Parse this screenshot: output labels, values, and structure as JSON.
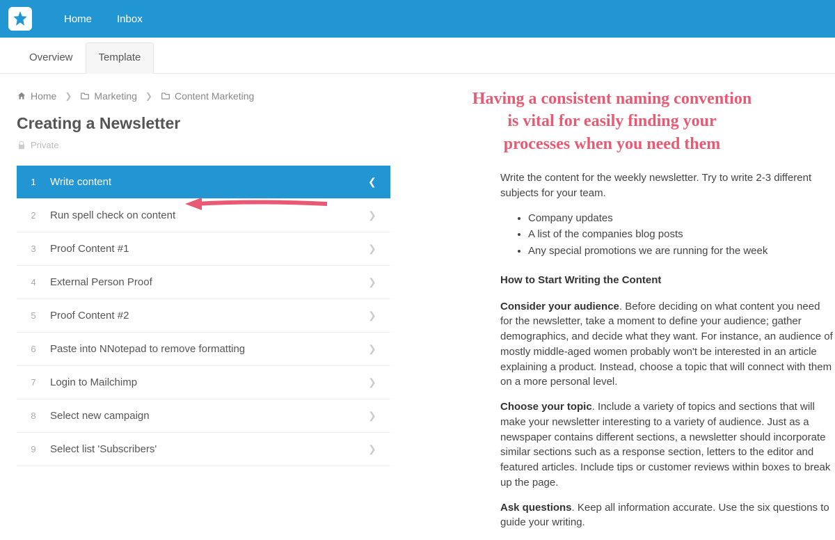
{
  "nav": {
    "home": "Home",
    "inbox": "Inbox"
  },
  "tabs": {
    "overview": "Overview",
    "template": "Template"
  },
  "breadcrumb": {
    "home": "Home",
    "marketing": "Marketing",
    "content_marketing": "Content Marketing"
  },
  "page_title": "Creating a Newsletter",
  "privacy": "Private",
  "steps": [
    {
      "n": "1",
      "label": "Write content",
      "active": true
    },
    {
      "n": "2",
      "label": "Run spell check on content"
    },
    {
      "n": "3",
      "label": "Proof Content #1"
    },
    {
      "n": "4",
      "label": "External Person Proof"
    },
    {
      "n": "5",
      "label": "Proof Content #2"
    },
    {
      "n": "6",
      "label": "Paste into NNotepad to remove formatting"
    },
    {
      "n": "7",
      "label": "Login to Mailchimp"
    },
    {
      "n": "8",
      "label": "Select new campaign"
    },
    {
      "n": "9",
      "label": "Select list 'Subscribers'"
    }
  ],
  "annotation": {
    "l1": "Having a consistent naming convention",
    "l2": "is vital for easily finding your",
    "l3": "processes when you need them"
  },
  "doc": {
    "intro": "Write the content for the weekly newsletter. Try to write 2-3 different subjects for your team.",
    "bullets": [
      "Company updates",
      "A list of the companies blog posts",
      "Any special promotions we are running for the week"
    ],
    "h1": "How to Start Writing the Content",
    "p1_lead": "Consider your audience",
    "p1_rest": ". Before deciding on what content you need for the newsletter, take a moment to define your audience; gather demographics, and decide what they want. For instance, an audience of mostly middle-aged women probably won't be interested in an article explaining a product. Instead, choose a topic that will connect with them on a more personal level.",
    "p2_lead": "Choose your topic",
    "p2_rest": ". Include a variety of topics and sections that will make your newsletter interesting to a variety of audience. Just as a newspaper contains different sections, a newsletter should incorporate similar sections such as a response section, letters to the editor and featured articles. Include tips or customer reviews within boxes to break up the page.",
    "p3_lead": "Ask questions",
    "p3_rest": ". Keep all information accurate. Use the six questions to guide your writing."
  }
}
